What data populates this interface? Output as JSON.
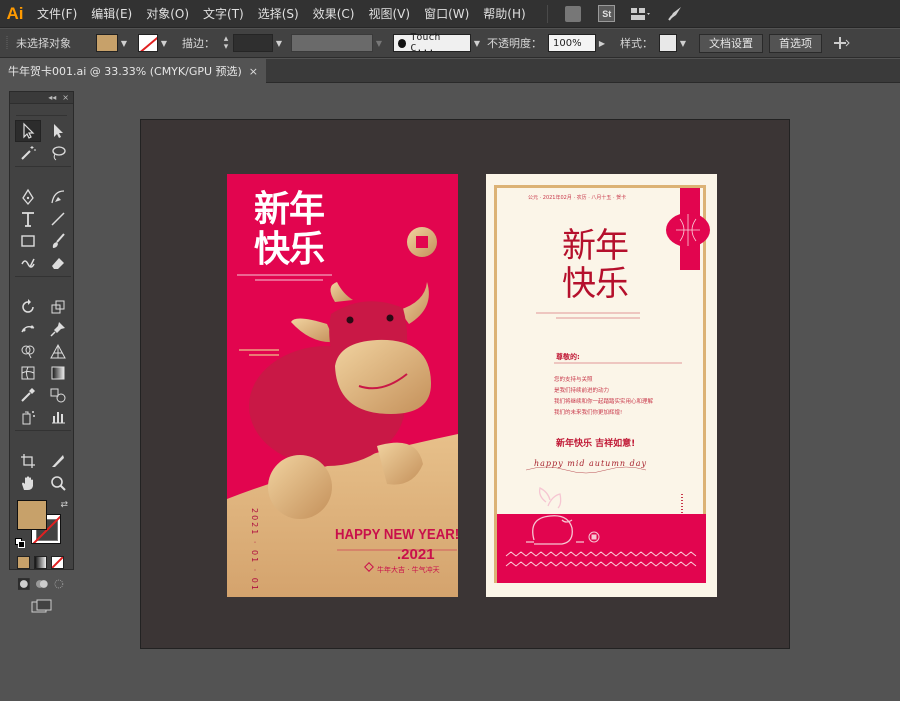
{
  "app": {
    "logo": "Ai"
  },
  "menu": [
    "文件(F)",
    "编辑(E)",
    "对象(O)",
    "文字(T)",
    "选择(S)",
    "效果(C)",
    "视图(V)",
    "窗口(W)",
    "帮助(H)"
  ],
  "menubar_icons": {
    "bridge": "Br",
    "stock": "St",
    "workspace": "workspace-icon",
    "gpu": "rocket-icon"
  },
  "control_bar": {
    "selection_state": "未选择对象",
    "fill_color": "#c7a16a",
    "stroke_label": "描边：",
    "brush_label": "Touch C...",
    "opacity_label": "不透明度：",
    "opacity_value": "100%",
    "style_label": "样式：",
    "doc_setup_button": "文档设置",
    "preferences_button": "首选项"
  },
  "document_tab": {
    "title": "牛年贺卡001.ai @ 33.33% (CMYK/GPU 预选)",
    "close": "×"
  },
  "tools_panel": {
    "collapse": "◂◂",
    "close": "×"
  },
  "colors": {
    "card_red": "#e2054f",
    "card_gold": "#dcb275",
    "card_cream": "#fbf5e8",
    "title_red": "#b5102c"
  },
  "card_red": {
    "title_line1": "新年",
    "title_line2": "快乐",
    "greeting": "HAPPY NEW YEAR!",
    "year": ".2021",
    "date": "2021 · 01 · 01",
    "footer": "牛年大吉 · 牛气冲天"
  },
  "card_cream": {
    "header": "公元 · 2021年02月 · 农历 · 八月十五 · 贺卡",
    "title_line1": "新年",
    "title_line2": "快乐",
    "salutation": "尊敬的:",
    "body_lines": [
      "您的支持与关照",
      "是我们持续前进的动力",
      "我们将继续和你一起踏踏实实用心和理解",
      "我们的未来我们你更加辉煌!"
    ],
    "wish": "新年快乐 吉祥如意!",
    "signature_script": "happy mid autumn day"
  }
}
